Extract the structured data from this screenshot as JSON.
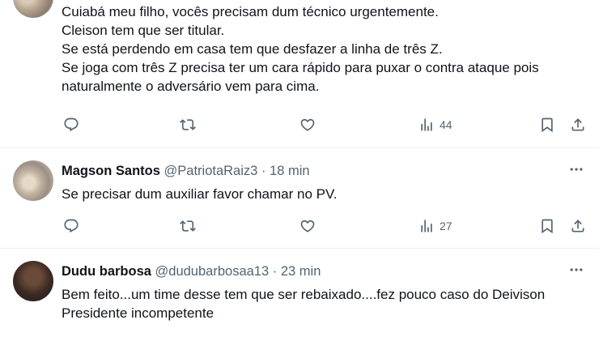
{
  "tweets": [
    {
      "text": "Cuiabá meu filho, vocês precisam dum técnico urgentemente.\nCleison tem que ser titular.\nSe está perdendo em casa tem que desfazer a linha de três Z.\nSe joga com três Z precisa ter um cara rápido para puxar o contra ataque pois naturalmente o adversário vem para cima.",
      "views": "44"
    },
    {
      "name": "Magson Santos",
      "handle": "@PatriotaRaiz3",
      "dot": "·",
      "time": "18 min",
      "text": "Se precisar dum auxiliar favor chamar no PV.",
      "views": "27"
    },
    {
      "name": "Dudu barbosa",
      "handle": "@dudubarbosaa13",
      "dot": "·",
      "time": "23 min",
      "text": "Bem feito...um time desse tem que ser rebaixado....fez pouco caso do Deivison\nPresidente incompetente"
    }
  ],
  "icons": {
    "reply": "reply-icon",
    "retweet": "retweet-icon",
    "like": "heart-icon",
    "views": "views-icon",
    "bookmark": "bookmark-icon",
    "share": "share-icon",
    "more": "more-icon"
  },
  "colors": {
    "muted": "#536471",
    "text": "#0f1419",
    "divider": "#eff3f4"
  }
}
